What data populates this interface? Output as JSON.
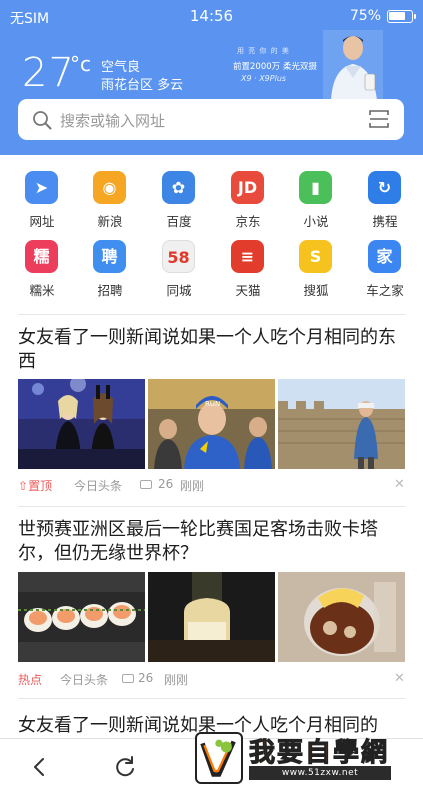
{
  "status_bar": {
    "carrier": "无SIM",
    "time": "14:56",
    "battery_text": "75%",
    "battery_level": 0.75
  },
  "weather": {
    "temperature": "27",
    "unit": "°c",
    "air_quality": "空气良",
    "location": "雨花台区 多云"
  },
  "ad": {
    "line1": "用 亮 你 的 美",
    "line2": "前置2000万 柔光双摄",
    "line3": "X9 · X9Plus"
  },
  "search": {
    "placeholder": "搜索或输入网址",
    "icon": "search-icon",
    "scan_icon": "scan-icon"
  },
  "quick_links": [
    {
      "label": "网址",
      "glyph": "➤",
      "color": "#4a8cf0"
    },
    {
      "label": "新浪",
      "glyph": "◉",
      "color": "#f5a623"
    },
    {
      "label": "百度",
      "glyph": "✿",
      "color": "#3d86e6"
    },
    {
      "label": "京东",
      "glyph": "JD",
      "color": "#e84a3c"
    },
    {
      "label": "小说",
      "glyph": "▮",
      "color": "#4bc05a"
    },
    {
      "label": "携程",
      "glyph": "↻",
      "color": "#2f7ee8"
    },
    {
      "label": "糯米",
      "glyph": "糯",
      "color": "#ec3d5c"
    },
    {
      "label": "招聘",
      "glyph": "聘",
      "color": "#3f8ef0"
    },
    {
      "label": "同城",
      "glyph": "58",
      "color": "#f0f0f0"
    },
    {
      "label": "天猫",
      "glyph": "≡",
      "color": "#e23c2c"
    },
    {
      "label": "搜狐",
      "glyph": "S",
      "color": "#f6c21e"
    },
    {
      "label": "车之家",
      "glyph": "家",
      "color": "#3b86f0"
    }
  ],
  "news": [
    {
      "title": "女友看了一则新闻说如果一个人吃个月相同的东西",
      "tag": "置顶",
      "source": "今日头条",
      "comments": "26",
      "time": "刚刚"
    },
    {
      "title": "世预赛亚洲区最后一轮比赛国足客场击败卡塔尔，但仍无缘世界杯？",
      "tag": "热点",
      "source": "今日头条",
      "comments": "26",
      "time": "刚刚"
    },
    {
      "title": "女友看了一则新闻说如果一个人吃个月相同的"
    }
  ],
  "watermark": {
    "text": "我要自學網",
    "url": "www.51zxw.net"
  },
  "colors": {
    "header_bg": "#5a94f0",
    "tag_red": "#f05b5b"
  }
}
